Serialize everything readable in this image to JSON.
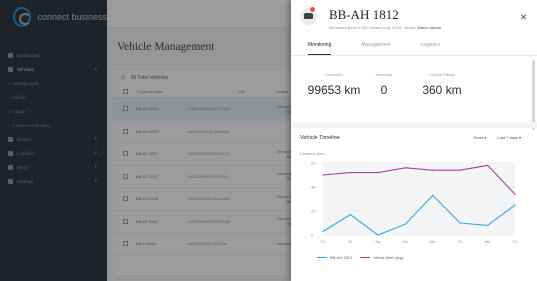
{
  "sidebar": {
    "brand": "connect business",
    "items": [
      {
        "label": "Dashboard",
        "kind": "top"
      },
      {
        "label": "Vehicles",
        "kind": "top",
        "active": true
      },
      {
        "label": "Management",
        "kind": "sub"
      },
      {
        "label": "Health",
        "kind": "sub"
      },
      {
        "label": "Usage",
        "kind": "sub"
      },
      {
        "label": "Contract and costs",
        "kind": "sub"
      },
      {
        "label": "Drivers",
        "kind": "top"
      },
      {
        "label": "Logistics",
        "kind": "top"
      },
      {
        "label": "Store",
        "kind": "top"
      },
      {
        "label": "Settings",
        "kind": "top"
      }
    ]
  },
  "main": {
    "title": "Vehicle Management",
    "total_label": "39 Total Vehicles",
    "columns": {
      "plate": "License plate",
      "vin": "VIN",
      "brand": "Brand"
    },
    "rows": [
      {
        "plate": "BB-AH 1812",
        "vin": "WDD2049021G210185",
        "brand": "Mercedes-Benz",
        "selected": true
      },
      {
        "plate": "BB-AM 6099",
        "vin": "WDD1179441N098656",
        "brand": ""
      },
      {
        "plate": "BB-AT 3297",
        "vin": "WDD2049021G215175",
        "brand": "Mercedes-Benz"
      },
      {
        "plate": "BB-DZ 1011",
        "vin": "WDD2049021G210191",
        "brand": "Mercedes-Benz"
      },
      {
        "plate": "BB-DZ 2428",
        "vin": "WDD2049021G210188",
        "brand": "Mercedes-Benz"
      },
      {
        "plate": "BB-LP 9948",
        "vin": "WDD2049021G210198",
        "brand": "Mercedes-Benz"
      },
      {
        "plate": "BB-LI 8851",
        "vin": "WDD2049021G2103x",
        "brand": "Mercedes-"
      }
    ]
  },
  "panel": {
    "title": "BB-AH 1812",
    "subtitle_prefix": "Mercedes-Benz E 300 Sedan long, 2016 · Driver:",
    "driver": "Marco Neuss",
    "close": "×",
    "tabs": [
      "Monitoring",
      "Management",
      "Logistics"
    ],
    "stats": [
      {
        "label": "Odometer",
        "value": "99653 km"
      },
      {
        "label": "Warnings",
        "value": "0"
      },
      {
        "label": "Vehicle Range",
        "value": "360 km"
      }
    ],
    "timeline_title": "Vehicle Timeline",
    "controls": {
      "filter": "None ▾",
      "range": "Last 7 days ▾"
    },
    "y_axis_label": "Distance (km)"
  },
  "chart_data": {
    "type": "line",
    "x": [
      "Th",
      "Fr",
      "Sa",
      "Su",
      "Mo",
      "Tu",
      "We",
      "Th"
    ],
    "ylim": [
      0,
      60
    ],
    "yticks": [
      0,
      20,
      40,
      60
    ],
    "ytick_labels": [
      "0",
      "20",
      "40",
      "60"
    ],
    "ylabel": "Distance (km)",
    "series": [
      {
        "name": "BB-AH 1812",
        "color": "#39a7de",
        "values": [
          3,
          17,
          0,
          9,
          33,
          10,
          8,
          25
        ]
      },
      {
        "name": "Whole fleet (avg)",
        "color": "#b03b9e",
        "values": [
          50,
          52,
          52,
          56,
          54,
          54,
          58,
          34
        ]
      }
    ],
    "legend_position": "bottom-left",
    "grid": true
  }
}
